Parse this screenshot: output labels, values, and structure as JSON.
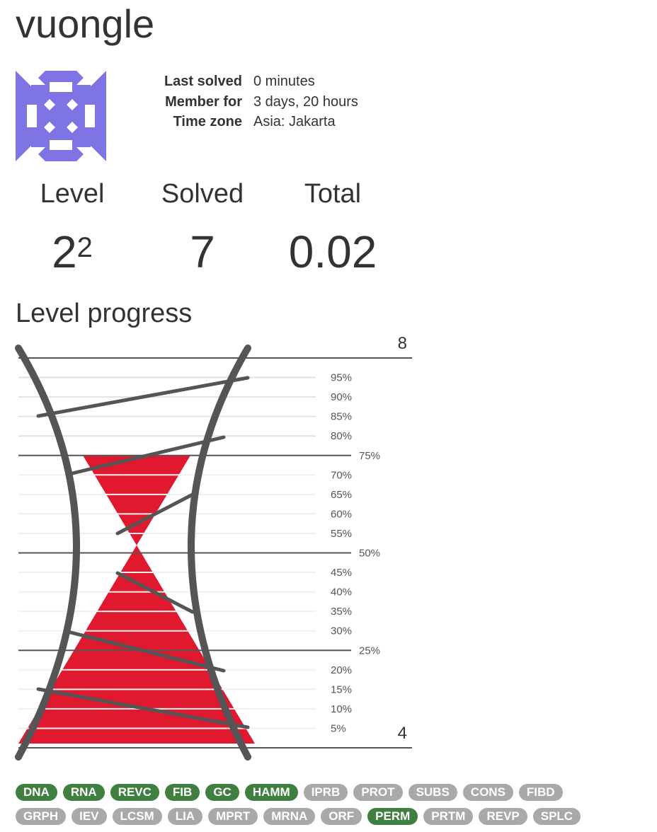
{
  "profile": {
    "username": "vuongle",
    "info": [
      {
        "label": "Last solved",
        "value": "0 minutes"
      },
      {
        "label": "Member for",
        "value": "3 days, 20 hours"
      },
      {
        "label": "Time zone",
        "value": "Asia: Jakarta"
      }
    ]
  },
  "stats": {
    "level_label": "Level",
    "level_base": "2",
    "level_exp": "2",
    "solved_label": "Solved",
    "solved_value": "7",
    "total_label": "Total",
    "total_value": "0.02"
  },
  "level_progress": {
    "title": "Level progress",
    "top_value": "8",
    "bottom_value": "4",
    "progress_fraction": 0.75,
    "fill_color": "#e0192e",
    "helix_color": "#555555",
    "percent_ticks": [
      "95%",
      "90%",
      "85%",
      "80%",
      "75%",
      "70%",
      "65%",
      "60%",
      "55%",
      "50%",
      "45%",
      "40%",
      "35%",
      "30%",
      "25%",
      "20%",
      "15%",
      "10%",
      "5%"
    ]
  },
  "problems": {
    "rows": [
      [
        {
          "code": "DNA",
          "solved": true
        },
        {
          "code": "RNA",
          "solved": true
        },
        {
          "code": "REVC",
          "solved": true
        },
        {
          "code": "FIB",
          "solved": true
        },
        {
          "code": "GC",
          "solved": true
        },
        {
          "code": "HAMM",
          "solved": true
        },
        {
          "code": "IPRB",
          "solved": false
        },
        {
          "code": "PROT",
          "solved": false
        },
        {
          "code": "SUBS",
          "solved": false
        },
        {
          "code": "CONS",
          "solved": false
        },
        {
          "code": "FIBD",
          "solved": false
        }
      ],
      [
        {
          "code": "GRPH",
          "solved": false
        },
        {
          "code": "IEV",
          "solved": false
        },
        {
          "code": "LCSM",
          "solved": false
        },
        {
          "code": "LIA",
          "solved": false
        },
        {
          "code": "MPRT",
          "solved": false
        },
        {
          "code": "MRNA",
          "solved": false
        },
        {
          "code": "ORF",
          "solved": false
        },
        {
          "code": "PERM",
          "solved": true
        },
        {
          "code": "PRTM",
          "solved": false
        },
        {
          "code": "REVP",
          "solved": false
        },
        {
          "code": "SPLC",
          "solved": false
        }
      ]
    ]
  }
}
